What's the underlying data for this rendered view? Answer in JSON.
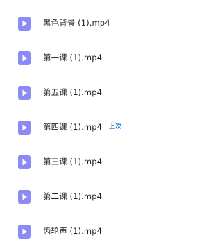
{
  "files": [
    {
      "name": "黑色背景 (1).mp4",
      "icon": "video-file-icon",
      "badge": ""
    },
    {
      "name": "第一课 (1).mp4",
      "icon": "video-file-icon",
      "badge": ""
    },
    {
      "name": "第五课 (1).mp4",
      "icon": "video-file-icon",
      "badge": ""
    },
    {
      "name": "第四课 (1).mp4",
      "icon": "video-file-icon",
      "badge": "上次"
    },
    {
      "name": "第三课 (1).mp4",
      "icon": "video-file-icon",
      "badge": ""
    },
    {
      "name": "第二课 (1).mp4",
      "icon": "video-file-icon",
      "badge": ""
    },
    {
      "name": "齿轮声 (1).mp4",
      "icon": "video-file-icon",
      "badge": ""
    }
  ],
  "colors": {
    "icon_fill": "#8c8bf6",
    "icon_play": "#ffffff",
    "text": "#1f2329",
    "badge": "#2b7de9"
  }
}
